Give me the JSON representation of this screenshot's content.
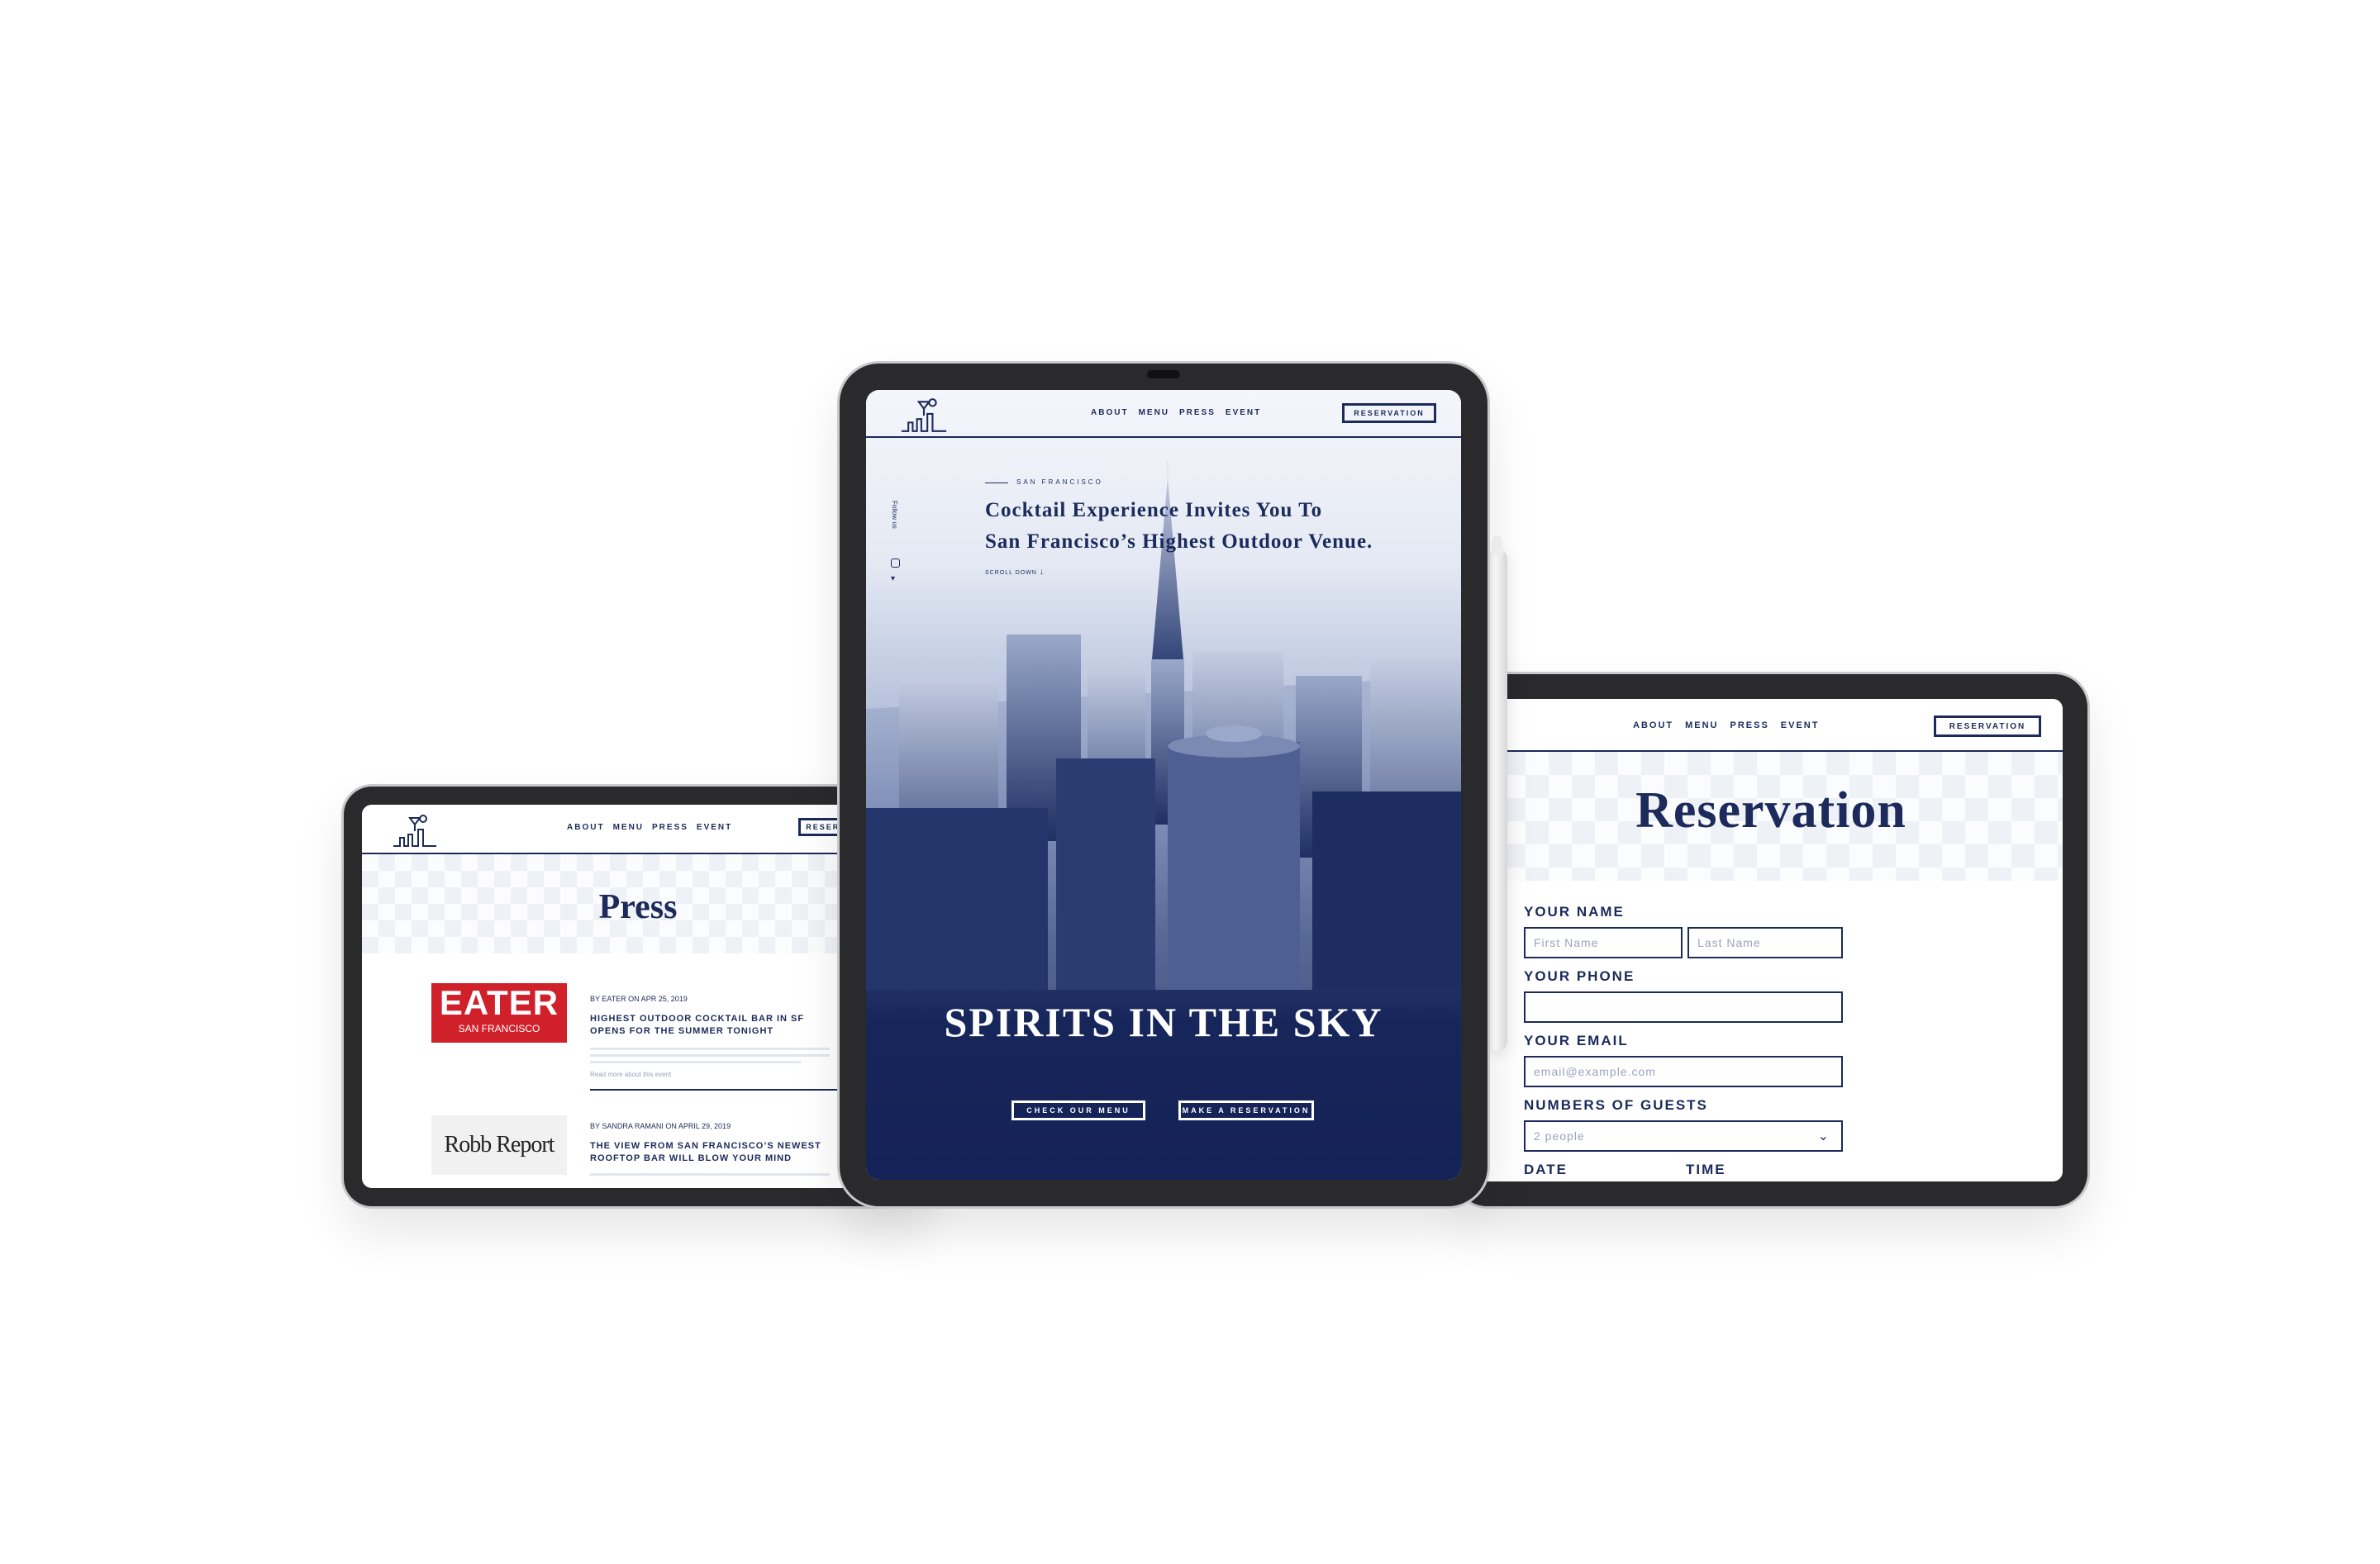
{
  "nav": {
    "about": "ABOUT",
    "menu": "MENU",
    "press": "PRESS",
    "event": "EVENT",
    "reservation": "RESERVATION"
  },
  "home": {
    "eyebrow": "SAN FRANCISCO",
    "headline_1": "Cocktail Experience Invites You To",
    "headline_2": "San Francisco’s Highest Outdoor Venue.",
    "scroll": "SCROLL DOWN",
    "social_label": "Follow us",
    "big_title": "SPIRITS IN THE SKY",
    "btn_menu": "CHECK OUR MENU",
    "btn_reserve": "MAKE A RESERVATION"
  },
  "press": {
    "title": "Press",
    "items": [
      {
        "logo_main": "EATER",
        "logo_sub": "SAN FRANCISCO",
        "byline": "BY EATER ON APR 25, 2019",
        "headline": "HIGHEST OUTDOOR COCKTAIL BAR IN SF OPENS FOR THE SUMMER TONIGHT",
        "read_more": "Read more about this event"
      },
      {
        "logo_main": "Robb Report",
        "byline": "BY SANDRA RAMANI ON APRIL 29, 2019",
        "headline": "THE VIEW FROM SAN FRANCISCO’S NEWEST ROOFTOP BAR WILL BLOW YOUR MIND"
      }
    ]
  },
  "reservation": {
    "title": "Reservation",
    "name_label": "YOUR NAME",
    "first_placeholder": "First Name",
    "last_placeholder": "Last Name",
    "phone_label": "YOUR PHONE",
    "email_label": "YOUR EMAIL",
    "email_placeholder": "email@example.com",
    "guests_label": "NUMBERS OF GUESTS",
    "guests_value": "2 people",
    "date_label": "DATE",
    "time_label": "TIME"
  },
  "colors": {
    "navy": "#1c2a5c",
    "eater_red": "#d0202a"
  }
}
